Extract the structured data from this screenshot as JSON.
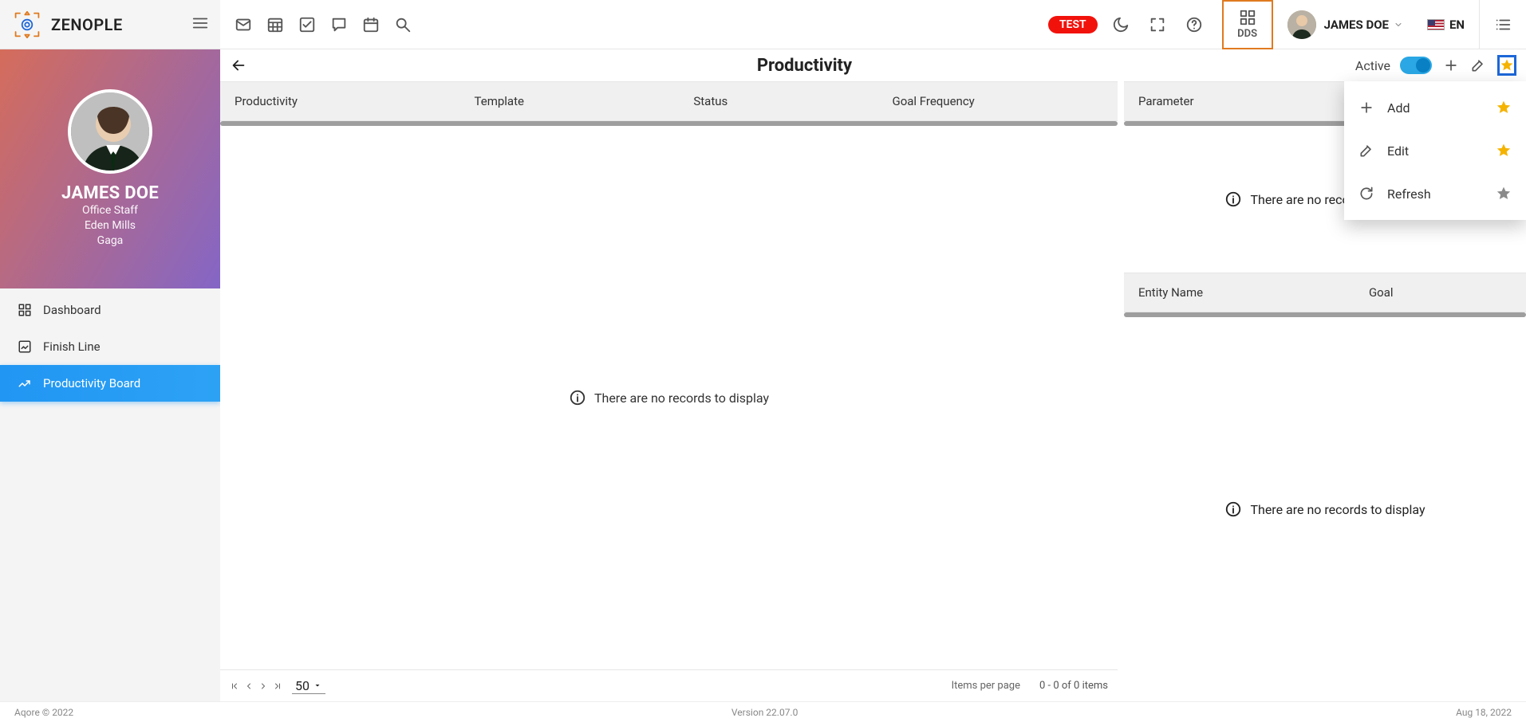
{
  "brand": "ZENOPLE",
  "topbar": {
    "test_badge": "TEST",
    "dds_label": "DDS",
    "user": "JAMES DOE",
    "language": "EN"
  },
  "profile": {
    "name": "JAMES DOE",
    "role": "Office Staff",
    "location": "Eden Mills",
    "extra": "Gaga"
  },
  "nav": {
    "dashboard": "Dashboard",
    "finish_line": "Finish Line",
    "productivity_board": "Productivity Board"
  },
  "page": {
    "title": "Productivity",
    "active_label": "Active"
  },
  "grid_main": {
    "cols": {
      "c1": "Productivity",
      "c2": "Template",
      "c3": "Status",
      "c4": "Goal Frequency"
    },
    "empty": "There are no records to display"
  },
  "grid_param": {
    "cols": {
      "c1": "Parameter"
    },
    "empty": "There are no records to display"
  },
  "grid_entity": {
    "cols": {
      "c1": "Entity Name",
      "c2": "Goal"
    },
    "empty": "There are no records to display"
  },
  "pager": {
    "size": "50",
    "items_per_page": "Items per page",
    "range": "0 - 0 of 0 items"
  },
  "menu": {
    "add": "Add",
    "edit": "Edit",
    "refresh": "Refresh"
  },
  "footer": {
    "left": "Aqore © 2022",
    "mid": "Version 22.07.0",
    "right": "Aug 18, 2022"
  }
}
